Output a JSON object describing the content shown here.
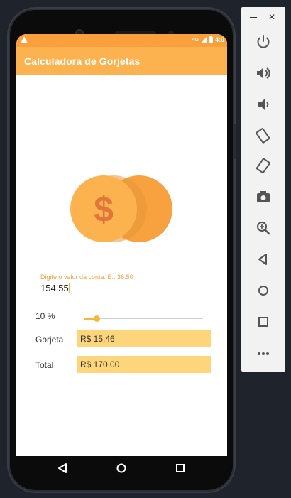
{
  "app": {
    "title": "Calculadora de Gorjetas"
  },
  "status_bar": {
    "time": "4:0",
    "network": "4G"
  },
  "bill": {
    "placeholder": "Digite o valor da conta. E.: 36.50",
    "value": "154.55"
  },
  "tip": {
    "percent_label": "10 %",
    "slider_fraction": 0.1
  },
  "rows": {
    "tip_label": "Gorjeta",
    "tip_value": "R$ 15.46",
    "total_label": "Total",
    "total_value": "R$ 170.00"
  },
  "colors": {
    "primary": "#fcb34f",
    "primary_dark": "#f9a03c",
    "value_box": "#fdd67b",
    "accent": "#f4b83d"
  },
  "icons": {
    "nav_back": "back-triangle-icon",
    "nav_home": "home-circle-icon",
    "nav_recent": "recent-square-icon"
  },
  "emulator_panel": {
    "tools": [
      "power",
      "volume-up",
      "volume-down",
      "rotate-left",
      "rotate-right",
      "screenshot",
      "zoom",
      "back",
      "home",
      "overview",
      "more"
    ]
  }
}
